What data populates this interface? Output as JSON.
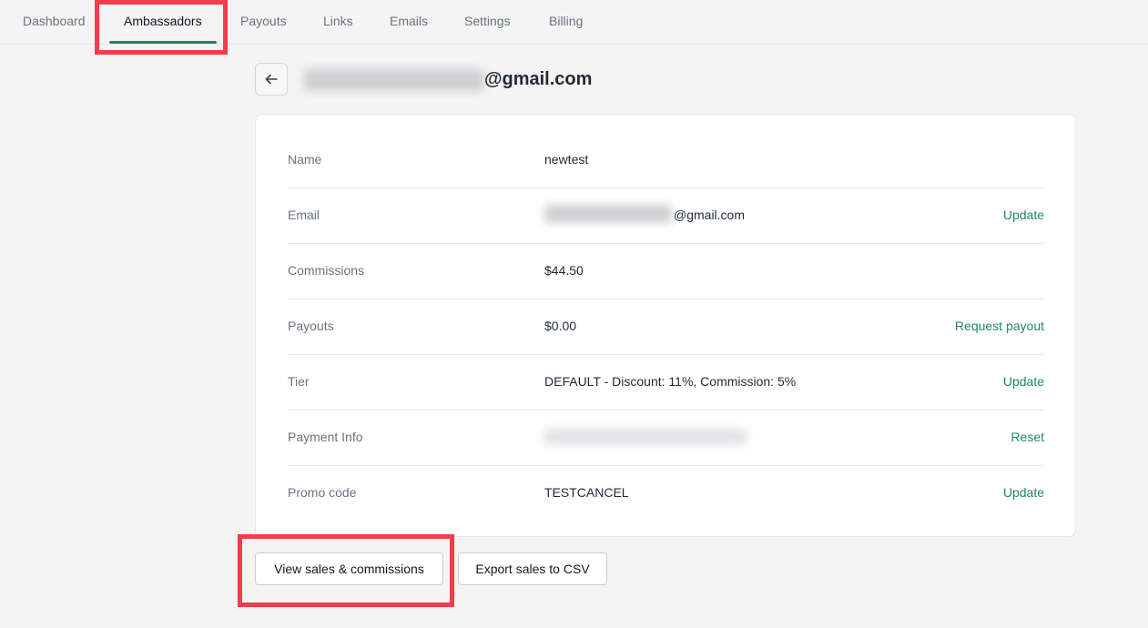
{
  "nav": {
    "tabs": [
      {
        "label": "Dashboard"
      },
      {
        "label": "Ambassadors",
        "active": true
      },
      {
        "label": "Payouts"
      },
      {
        "label": "Links"
      },
      {
        "label": "Emails"
      },
      {
        "label": "Settings"
      },
      {
        "label": "Billing"
      }
    ]
  },
  "header": {
    "email_suffix": "@gmail.com"
  },
  "details": {
    "rows": [
      {
        "label": "Name",
        "value": "newtest",
        "action": ""
      },
      {
        "label": "Email",
        "value_suffix": "@gmail.com",
        "action": "Update"
      },
      {
        "label": "Commissions",
        "value": "$44.50",
        "action": ""
      },
      {
        "label": "Payouts",
        "value": "$0.00",
        "action": "Request payout"
      },
      {
        "label": "Tier",
        "value": "DEFAULT - Discount: 11%, Commission: 5%",
        "action": "Update"
      },
      {
        "label": "Payment Info",
        "value": "",
        "action": "Reset"
      },
      {
        "label": "Promo code",
        "value": "TESTCANCEL",
        "action": "Update"
      }
    ]
  },
  "actions": {
    "view_sales_label": "View sales & commissions",
    "export_label": "Export sales to CSV"
  },
  "colors": {
    "accent": "#1f8a5e",
    "highlight": "#f23d4a"
  }
}
